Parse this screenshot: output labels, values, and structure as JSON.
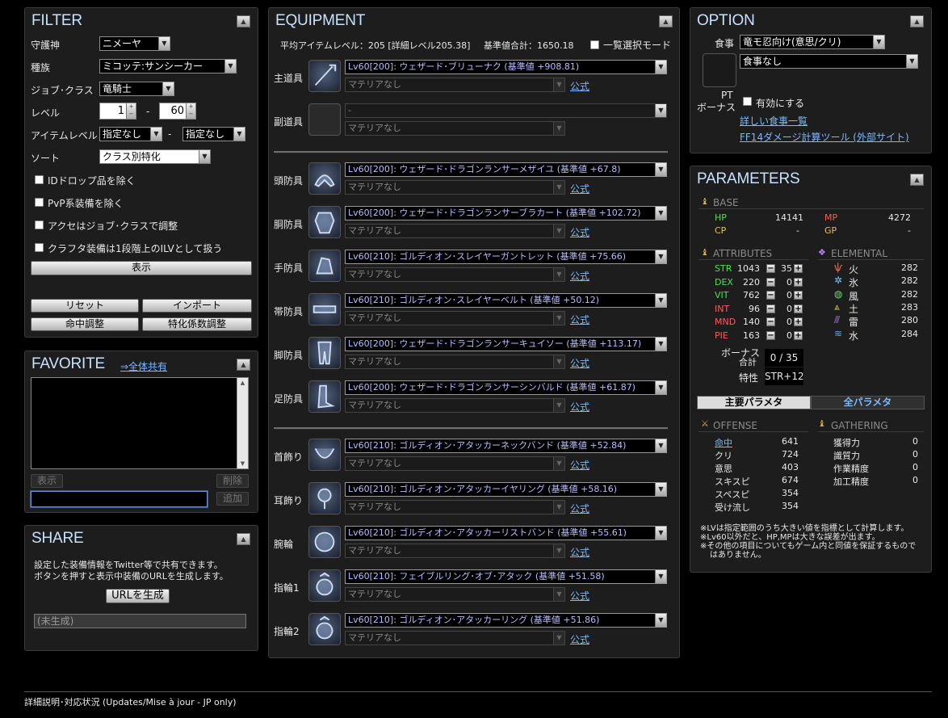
{
  "filter": {
    "title": "FILTER",
    "deity_label": "守護神",
    "deity": "ニメーヤ",
    "race_label": "種族",
    "race": "ミコッテ:サンシーカー",
    "job_label": "ジョブ･クラス",
    "job": "竜騎士",
    "level_label": "レベル",
    "level_min": "1",
    "level_max": "60",
    "ilvl_label": "アイテムレベル",
    "ilvl_min": "指定なし",
    "ilvl_max": "指定なし",
    "sort_label": "ソート",
    "sort": "クラス別特化",
    "dash": "-",
    "checks": [
      "IDドロップ品を除く",
      "PvP系装備を除く",
      "アクセはジョブ･クラスで調整",
      "クラフタ装備は1段階上のILVとして扱う"
    ],
    "show_btn": "表示",
    "reset_btn": "リセット",
    "import_btn": "インポート",
    "accuracy_btn": "命中調整",
    "coeff_btn": "特化係数調整"
  },
  "favorite": {
    "title": "FAVORITE",
    "share_link": "⇒全体共有",
    "show_btn": "表示",
    "delete_btn": "削除",
    "add_btn": "追加",
    "input_value": ""
  },
  "share": {
    "title": "SHARE",
    "desc1": "設定した装備情報をTwitter等で共有できます。",
    "desc2": "ボタンを押すと表示中装備のURLを生成します。",
    "gen_btn": "URLを生成",
    "url_placeholder": "(未生成)"
  },
  "equipment": {
    "title": "EQUIPMENT",
    "summary": "平均アイテムレベル：205 [詳細レベル205.38]",
    "base_total": "基準値合計：1650.18",
    "list_mode": "一覧選択モード",
    "official": "公式",
    "materia_none": "マテリアなし",
    "slots": [
      {
        "label": "主道具",
        "item": "Lv60[200]: ウェザード･ブリューナク (基準値 +908.81)",
        "icon": "spear-icon"
      },
      {
        "label": "副道具",
        "item": "-",
        "icon": "empty-slot-icon"
      },
      {
        "label": "頭防具",
        "item": "Lv60[200]: ウェザード･ドラゴンランサーメザイユ (基準値 +67.8)",
        "icon": "helm-icon"
      },
      {
        "label": "胴防具",
        "item": "Lv60[200]: ウェザード･ドラゴンランサーブラカート (基準値 +102.72)",
        "icon": "armor-icon"
      },
      {
        "label": "手防具",
        "item": "Lv60[210]: ゴルディオン･スレイヤーガントレット (基準値 +75.66)",
        "icon": "gauntlet-icon"
      },
      {
        "label": "帯防具",
        "item": "Lv60[210]: ゴルディオン･スレイヤーベルト (基準値 +50.12)",
        "icon": "belt-icon"
      },
      {
        "label": "脚防具",
        "item": "Lv60[200]: ウェザード･ドラゴンランサーキュイソー (基準値 +113.17)",
        "icon": "legs-icon"
      },
      {
        "label": "足防具",
        "item": "Lv60[200]: ウェザード･ドラゴンランサーシンバルド (基準値 +61.87)",
        "icon": "boots-icon"
      },
      {
        "label": "首飾り",
        "item": "Lv60[210]: ゴルディオン･アタッカーネックバンド (基準値 +52.84)",
        "icon": "necklace-icon"
      },
      {
        "label": "耳飾り",
        "item": "Lv60[210]: ゴルディオン･アタッカーイヤリング (基準値 +58.16)",
        "icon": "earring-icon"
      },
      {
        "label": "腕輪",
        "item": "Lv60[210]: ゴルディオン･アタッカーリストバンド (基準値 +55.61)",
        "icon": "bracelet-icon"
      },
      {
        "label": "指輪1",
        "item": "Lv60[210]: フェイブルリング･オブ･アタック (基準値 +51.58)",
        "icon": "ring-icon"
      },
      {
        "label": "指輪2",
        "item": "Lv60[210]: ゴルディオン･アタッカーリング (基準値 +51.86)",
        "icon": "ring-icon"
      }
    ]
  },
  "option": {
    "title": "OPTION",
    "food_label": "食事",
    "food1": "竜モ忍向け(意思/クリ)",
    "food2": "食事なし",
    "pt_label1": "PT",
    "pt_label2": "ボーナス",
    "pt_check": "有効にする",
    "food_list_link": "詳しい食事一覧",
    "dmg_tool_link": "FF14ダメージ計算ツール (外部サイト)"
  },
  "params": {
    "title": "PARAMETERS",
    "base_hdr": "BASE",
    "hp_label": "HP",
    "hp": "14141",
    "mp_label": "MP",
    "mp": "4272",
    "cp_label": "CP",
    "cp": "-",
    "gp_label": "GP",
    "gp": "-",
    "attr_hdr": "ATTRIBUTES",
    "elem_hdr": "ELEMENTAL",
    "attrs": [
      {
        "name": "STR",
        "val": "1043",
        "a": "35",
        "color": "#4fe04f"
      },
      {
        "name": "DEX",
        "val": "220",
        "a": "0",
        "color": "#4fe04f"
      },
      {
        "name": "VIT",
        "val": "762",
        "a": "0",
        "color": "#4fe04f"
      },
      {
        "name": "INT",
        "val": "96",
        "a": "0",
        "color": "#ff5a5a"
      },
      {
        "name": "MND",
        "val": "140",
        "a": "0",
        "color": "#ff5a5a"
      },
      {
        "name": "PIE",
        "val": "163",
        "a": "0",
        "color": "#ff5a5a"
      }
    ],
    "elems": [
      {
        "name": "火",
        "val": "282",
        "icon": "fire-icon",
        "glyph": "ѱ",
        "color": "#ff6a4a"
      },
      {
        "name": "氷",
        "val": "282",
        "icon": "ice-icon",
        "glyph": "✲",
        "color": "#7ac8ff"
      },
      {
        "name": "風",
        "val": "282",
        "icon": "wind-icon",
        "glyph": "◍",
        "color": "#6ad86a"
      },
      {
        "name": "土",
        "val": "283",
        "icon": "earth-icon",
        "glyph": "⩓",
        "color": "#e0c050"
      },
      {
        "name": "雷",
        "val": "280",
        "icon": "lightning-icon",
        "glyph": "⫻",
        "color": "#c080ff"
      },
      {
        "name": "水",
        "val": "284",
        "icon": "water-icon",
        "glyph": "≋",
        "color": "#5aa8ff"
      }
    ],
    "bonus_label1": "ボーナス",
    "bonus_label2": "合計",
    "bonus_val": "0 / 35",
    "trait_label": "特性",
    "trait_val": "STR+12",
    "tab_main": "主要パラメタ",
    "tab_all": "全パラメタ",
    "offense_hdr": "OFFENSE",
    "gather_hdr": "GATHERING",
    "offense": [
      {
        "name": "命中",
        "val": "641"
      },
      {
        "name": "クリ",
        "val": "724"
      },
      {
        "name": "意思",
        "val": "403"
      },
      {
        "name": "スキスピ",
        "val": "674"
      },
      {
        "name": "スペスピ",
        "val": "354"
      },
      {
        "name": "受け流し",
        "val": "354"
      }
    ],
    "gather": [
      {
        "name": "獲得力",
        "val": "0"
      },
      {
        "name": "識質力",
        "val": "0"
      },
      {
        "name": "作業精度",
        "val": "0"
      },
      {
        "name": "加工精度",
        "val": "0"
      }
    ],
    "note1": "※LVは指定範囲のうち大きい値を指標として計算します。",
    "note2": "※Lv60以外だと、HP,MPは大きな誤差が出ます。",
    "note3": "※その他の項目についてもゲーム内と同値を保証するもので",
    "note4": "はありません。"
  },
  "footer": {
    "text": "詳細説明･対応状況 (Updates/Mise à jour - JP only)"
  }
}
